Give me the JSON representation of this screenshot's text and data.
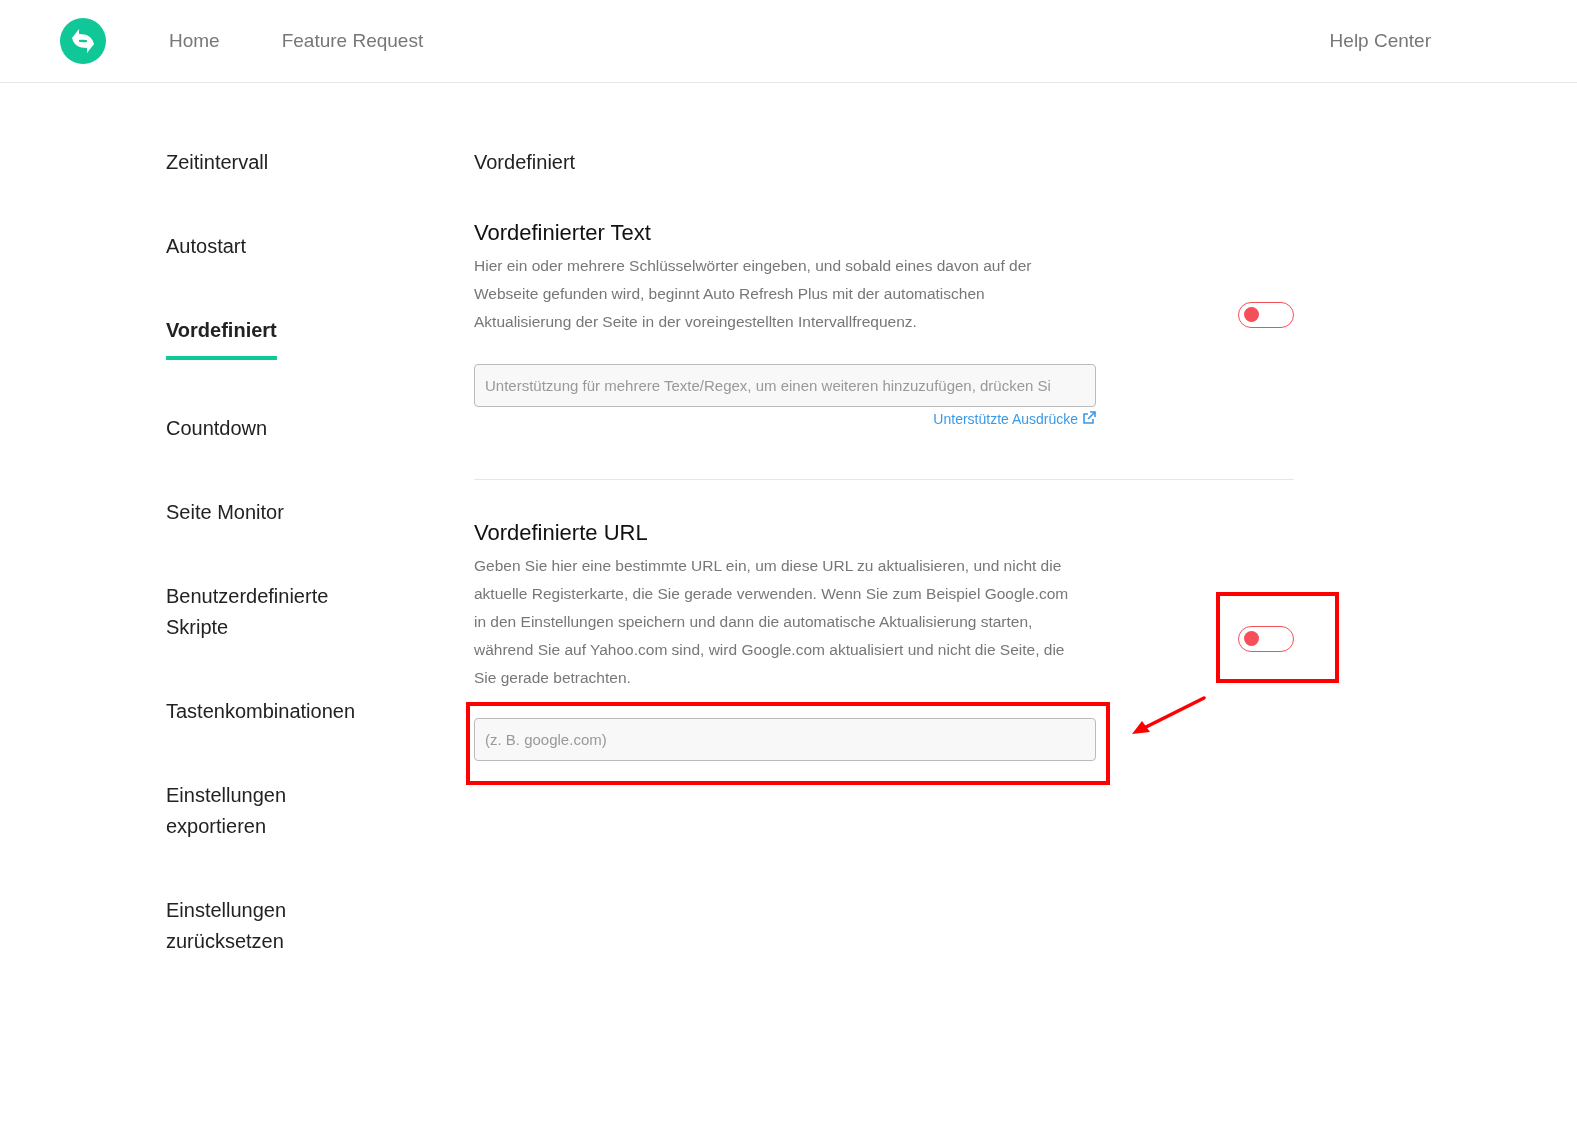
{
  "header": {
    "nav": [
      "Home",
      "Feature Request"
    ],
    "help": "Help Center"
  },
  "sidebar": {
    "items": [
      {
        "label": "Zeitintervall",
        "selected": false
      },
      {
        "label": "Autostart",
        "selected": false
      },
      {
        "label": "Vordefiniert",
        "selected": true
      },
      {
        "label": "Countdown",
        "selected": false
      },
      {
        "label": "Seite Monitor",
        "selected": false
      },
      {
        "label": "Benutzerdefinierte Skripte",
        "selected": false
      },
      {
        "label": "Tastenkombinationen",
        "selected": false
      },
      {
        "label": "Einstellungen exportieren",
        "selected": false
      },
      {
        "label": "Einstellungen zurücksetzen",
        "selected": false
      }
    ]
  },
  "page_title": "Vordefiniert",
  "sections": [
    {
      "title": "Vordefinierter Text",
      "description": "Hier ein oder mehrere Schlüsselwörter eingeben, und sobald eines davon auf der Webseite gefunden wird, beginnt Auto Refresh Plus mit der automatischen Aktualisierung der Seite in der voreingestellten Intervallfrequenz.",
      "on": false,
      "placeholder": "Unterstützung für mehrere Texte/Regex, um einen weiteren hinzuzufügen, drücken Si",
      "link": "Unterstützte Ausdrücke",
      "highlighted": false
    },
    {
      "title": "Vordefinierte URL",
      "description": "Geben Sie hier eine bestimmte URL ein, um diese URL zu aktualisieren, und nicht die aktuelle Registerkarte, die Sie gerade verwenden. Wenn Sie zum Beispiel Google.com in den Einstellungen speichern und dann die automatische Aktualisierung starten, während Sie auf Yahoo.com sind, wird Google.com aktualisiert und nicht die Seite, die Sie gerade betrachten.",
      "on": false,
      "placeholder": "(z. B. google.com)",
      "highlighted": true
    }
  ]
}
